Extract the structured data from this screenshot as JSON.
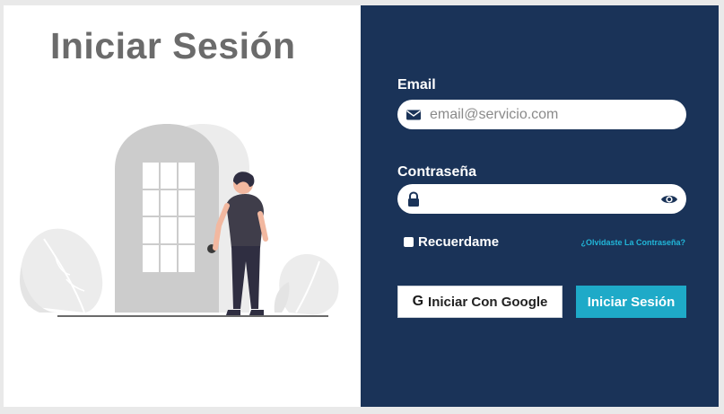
{
  "page": {
    "title": "Iniciar Sesión"
  },
  "form": {
    "email_label": "Email",
    "email_placeholder": "email@servicio.com",
    "email_value": "",
    "password_label": "Contraseña",
    "password_placeholder": "",
    "password_value": "",
    "remember_label": "Recuerdame",
    "forgot_link": "¿Olvidaste La Contraseña?",
    "google_button": "Iniciar Con Google",
    "google_glyph": "G",
    "login_button": "Iniciar Sesión"
  },
  "icons": {
    "email": "envelope-icon",
    "password": "lock-icon",
    "toggle": "eye-icon",
    "google": "google-icon"
  },
  "colors": {
    "panel": "#1a3358",
    "accent": "#1eaac8",
    "link": "#21b6d8",
    "title": "#6b6b6b"
  }
}
